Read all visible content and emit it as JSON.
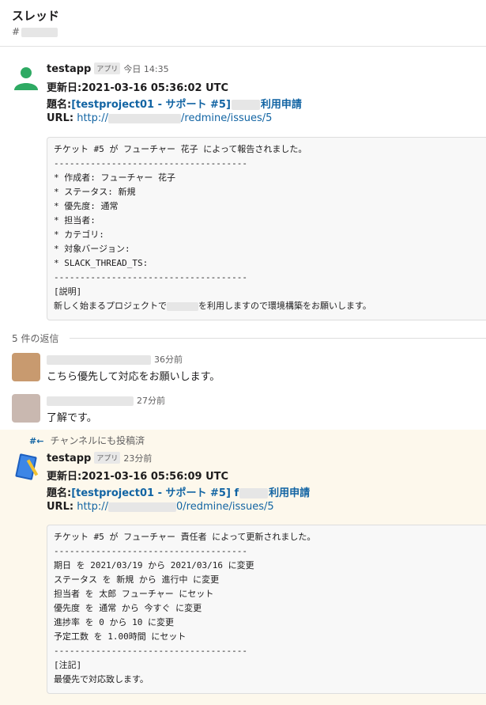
{
  "header": {
    "title": "スレッド",
    "channel_prefix": "#"
  },
  "parent": {
    "name": "testapp",
    "badge": "アプリ",
    "time": "今日 14:35",
    "updated_label": "更新日:",
    "updated_value": "2021-03-16 05:36:02 UTC",
    "subject_label": "題名:",
    "subject_link_a": "[testproject01 - サポート #5]",
    "subject_link_b": "利用申請",
    "url_label": "URL:",
    "url_a": "http://",
    "url_b": "/redmine/issues/5",
    "code_lines": [
      "チケット #5 が フューチャー 花子 によって報告されました。",
      "-------------------------------------",
      "* 作成者: フューチャー 花子",
      "* ステータス: 新規",
      "* 優先度: 通常",
      "* 担当者:",
      "* カテゴリ:",
      "* 対象バージョン:",
      "* SLACK_THREAD_TS:",
      "-------------------------------------",
      "[説明]"
    ],
    "code_last_a": "新しく始まるプロジェクトで",
    "code_last_b": "を利用しますので環境構築をお願いします。"
  },
  "replies_label": "5 件の返信",
  "reply1": {
    "time": "36分前",
    "text": "こちら優先して対応をお願いします。"
  },
  "reply2": {
    "time": "27分前",
    "text": "了解です。"
  },
  "also_posted": {
    "hash": "#←",
    "text": "チャンネルにも投稿済"
  },
  "reply3": {
    "name": "testapp",
    "badge": "アプリ",
    "time": "23分前",
    "updated_label": "更新日:",
    "updated_value": "2021-03-16 05:56:09 UTC",
    "subject_label": "題名:",
    "subject_link_a": "[testproject01 - サポート #5] f",
    "subject_link_b": "利用申請",
    "url_label": "URL:",
    "url_a": "http://",
    "url_b": "0/redmine/issues/5",
    "code_lines": [
      "チケット #5 が フューチャー 責任者 によって更新されました。",
      "-------------------------------------",
      "期日 を 2021/03/19 から 2021/03/16 に変更",
      "ステータス を 新規 から 進行中 に変更",
      "担当者 を 太郎 フューチャー にセット",
      "優先度 を 通常 から 今すぐ に変更",
      "進捗率 を 0 から 10 に変更",
      "予定工数 を 1.00時間 にセット",
      "-------------------------------------",
      "[注記]",
      "最優先で対応致します。"
    ]
  }
}
